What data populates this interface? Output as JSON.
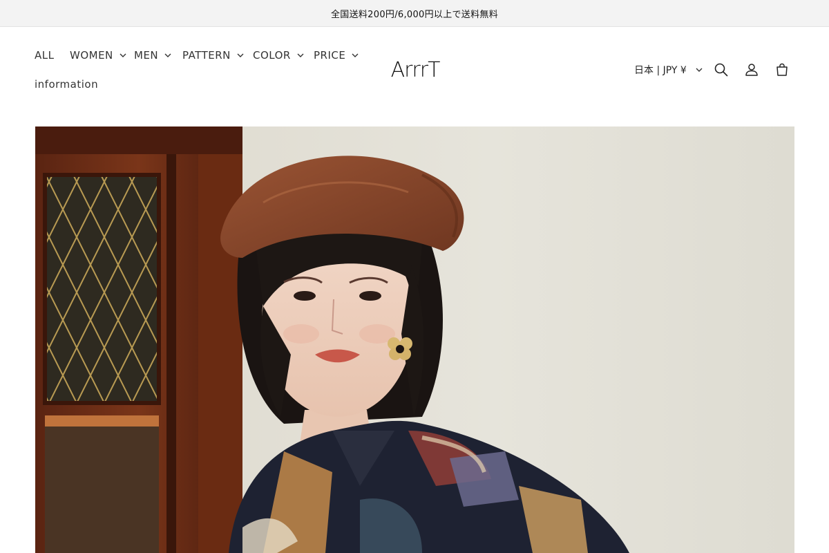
{
  "announcement": {
    "text": "全国送料200円/6,000円以上で送料無料"
  },
  "nav": {
    "items": [
      {
        "label": "ALL",
        "has_dropdown": false
      },
      {
        "label": "WOMEN",
        "has_dropdown": true
      },
      {
        "label": "MEN",
        "has_dropdown": true
      },
      {
        "label": "PATTERN",
        "has_dropdown": true
      },
      {
        "label": "COLOR",
        "has_dropdown": true
      },
      {
        "label": "PRICE",
        "has_dropdown": true
      },
      {
        "label": "information",
        "has_dropdown": false
      }
    ]
  },
  "brand": {
    "logo_text": "ArrrT"
  },
  "header_actions": {
    "locale_label": "日本 | JPY ¥",
    "icons": [
      "search-icon",
      "account-icon",
      "cart-icon"
    ]
  },
  "hero": {
    "image_subject": "woman in brown leather beret with patterned shirt beside wooden cabinet"
  },
  "colors": {
    "announcement_bg": "#f3f3f3",
    "text": "#121212",
    "wall": "#e3e0d6",
    "wood": "#6b2e18",
    "beret": "#8a4a2c"
  }
}
